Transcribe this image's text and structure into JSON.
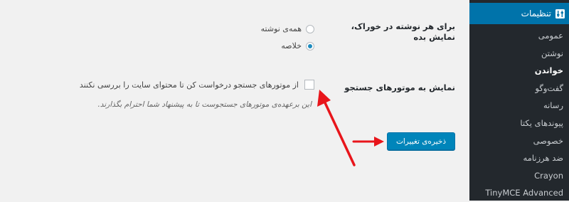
{
  "sidebar": {
    "header_label": "تنظیمات",
    "items": [
      {
        "label": "عمومی"
      },
      {
        "label": "نوشتن"
      },
      {
        "label": "خواندن"
      },
      {
        "label": "گفت‌وگو"
      },
      {
        "label": "رسانه"
      },
      {
        "label": "پیوندهای یکتا"
      },
      {
        "label": "خصوصی"
      },
      {
        "label": "ضد هرزنامه"
      },
      {
        "label": "Crayon"
      },
      {
        "label": "TinyMCE Advanced"
      }
    ],
    "current_index": 2
  },
  "form": {
    "feed_label_line1": "برای هر نوشته در خوراک،",
    "feed_label_line2": "نمایش بده",
    "radio_full": "همه‌ی نوشته",
    "radio_summary": "خلاصه",
    "selected": "summary",
    "search_label": "نمایش به موتورهای جستجو",
    "search_checkbox_text": "از موتورهای جستجو درخواست کن تا محتوای سایت را بررسی نکنند",
    "search_checked": false,
    "search_description": "این برعهده‌ی موتورهای جستجوست تا به پیشنهاد شما احترام بگذارند.",
    "save_button": "ذخیره‌ی تغییرات"
  },
  "colors": {
    "sidebar_bg": "#23282d",
    "active_menu": "#0073aa",
    "button": "#0085ba",
    "arrow": "#e8151b"
  }
}
